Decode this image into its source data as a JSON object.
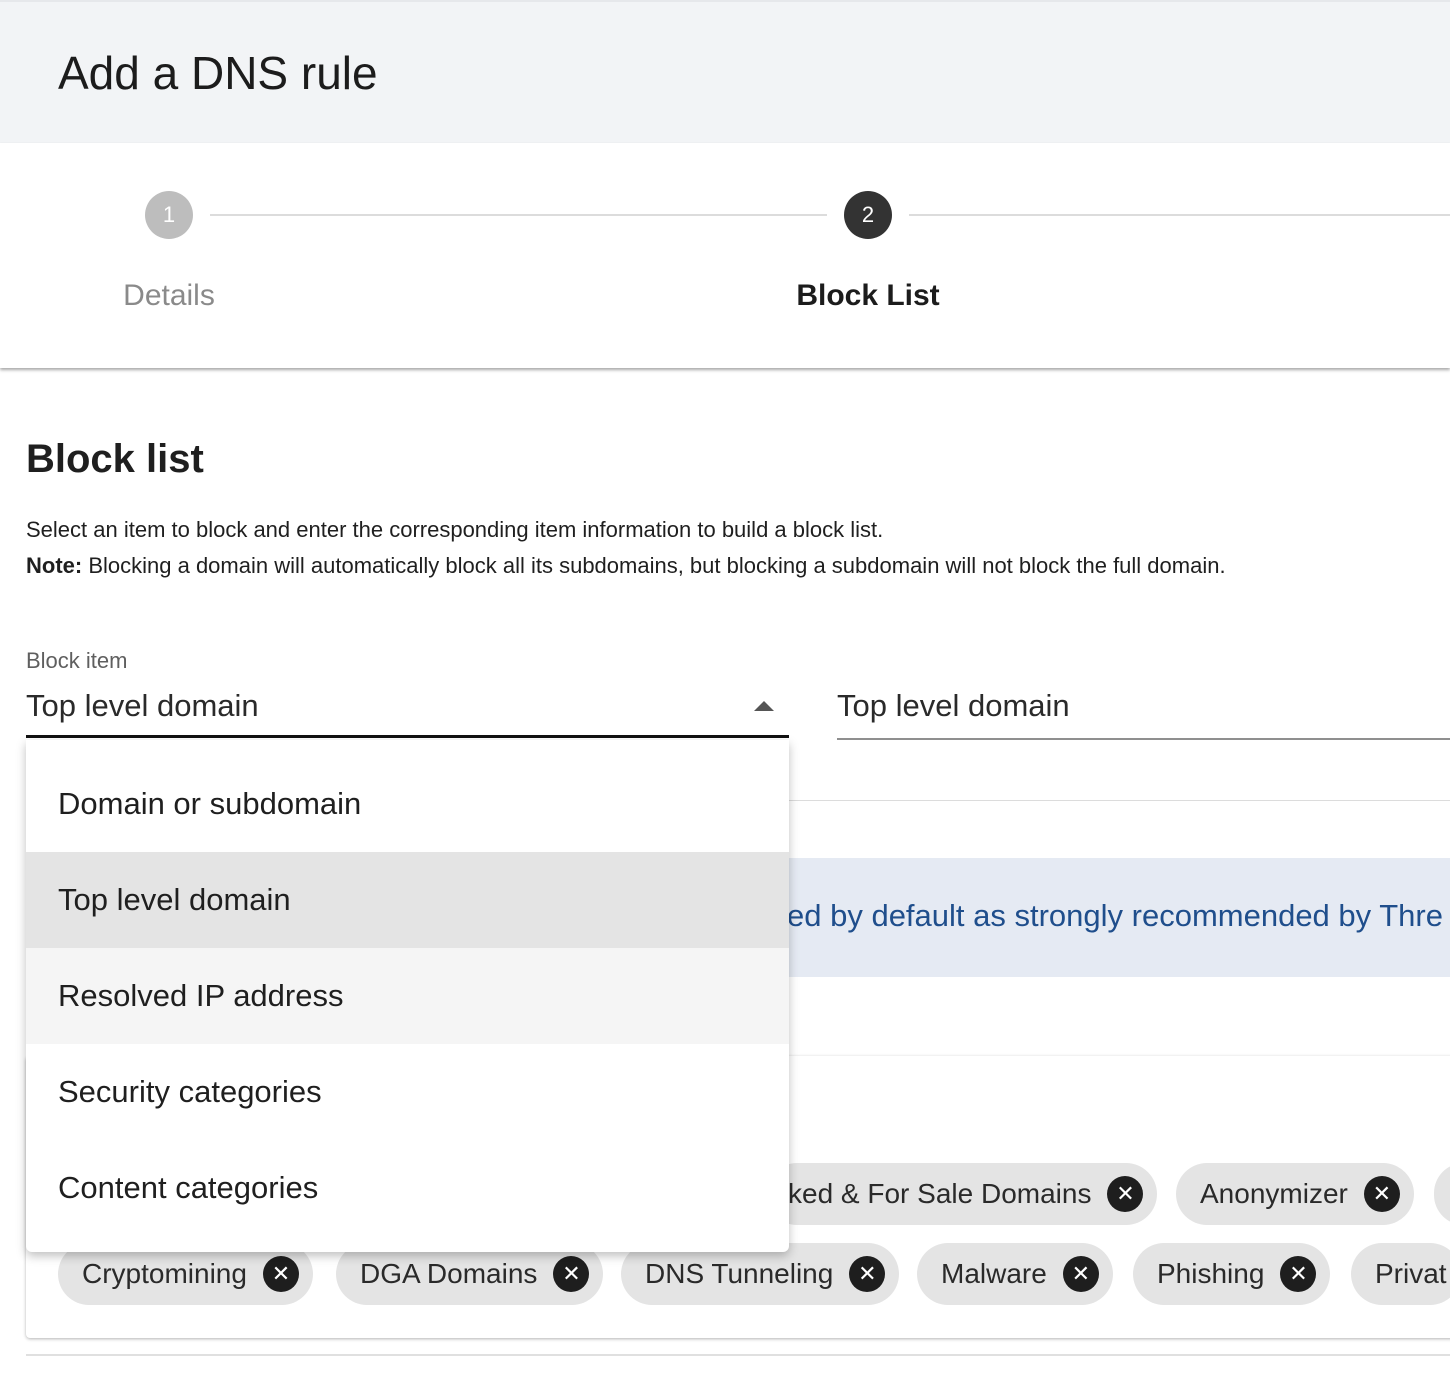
{
  "header": {
    "title": "Add a DNS rule"
  },
  "stepper": {
    "steps": [
      {
        "number": "1",
        "label": "Details"
      },
      {
        "number": "2",
        "label": "Block List"
      }
    ]
  },
  "section": {
    "title": "Block list",
    "description": "Select an item to block and enter the corresponding item information to build a block list.",
    "note_label": "Note:",
    "note_text": " Blocking a domain will automatically block all its subdomains, but blocking a subdomain will not block the full domain."
  },
  "block_item": {
    "label": "Block item",
    "value": "Top level domain",
    "options": [
      "Domain or subdomain",
      "Top level domain",
      "Resolved IP address",
      "Security categories",
      "Content categories"
    ]
  },
  "tld_field": {
    "value": "Top level domain"
  },
  "info_banner": {
    "text": "ed by default as strongly recommended by Thre"
  },
  "chips": {
    "row1": [
      "ked & For Sale Domains",
      "Anonymizer"
    ],
    "row2": [
      "Cryptomining",
      "DGA Domains",
      "DNS Tunneling",
      "Malware",
      "Phishing",
      "Privat"
    ]
  }
}
